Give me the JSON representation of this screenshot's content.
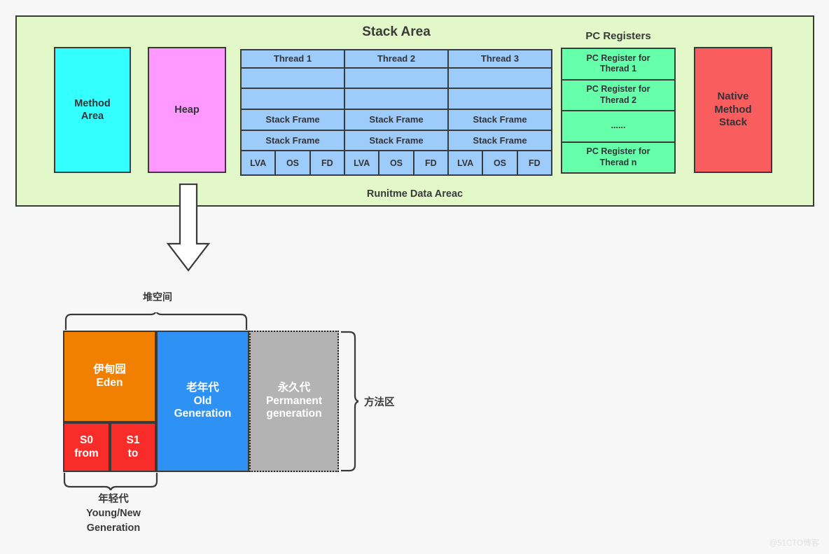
{
  "runtime": {
    "caption": "Runitme Data Areac",
    "method_area": "Method\nArea",
    "heap": "Heap",
    "native_method_stack": "Native\nMethod\nStack"
  },
  "stack_area": {
    "title": "Stack Area",
    "threads": [
      {
        "name": "Thread 1",
        "empty_rows": [
          "",
          ""
        ],
        "frames": [
          "Stack Frame",
          "Stack Frame"
        ],
        "parts": [
          "LVA",
          "OS",
          "FD"
        ]
      },
      {
        "name": "Thread 2",
        "empty_rows": [
          "",
          ""
        ],
        "frames": [
          "Stack Frame",
          "Stack Frame"
        ],
        "parts": [
          "LVA",
          "OS",
          "FD"
        ]
      },
      {
        "name": "Thread 3",
        "empty_rows": [
          "",
          ""
        ],
        "frames": [
          "Stack Frame",
          "Stack Frame"
        ],
        "parts": [
          "LVA",
          "OS",
          "FD"
        ]
      }
    ]
  },
  "pc_registers": {
    "title": "PC Registers",
    "cells": [
      "PC Register for\nTherad 1",
      "PC Register for\nTherad 2",
      "......",
      "PC Register for\nTherad n"
    ]
  },
  "heap_detail": {
    "heap_space_label": "堆空间",
    "young_gen_label": "年轻代\nYoung/New\nGeneration",
    "method_area_label": "方法区",
    "eden": "伊甸园\nEden",
    "s0": "S0\nfrom",
    "s1": "S1\nto",
    "old_generation": "老年代\nOld\nGeneration",
    "permanent_generation": "永久代\nPermanent\ngeneration"
  },
  "watermark": "@51CTO博客",
  "colors": {
    "page_background": "#f7f7f7",
    "runtime_background": "#e3f8c9",
    "outline": "#3a3a3a",
    "method_area": "#33ffff",
    "heap": "#ff99ff",
    "stack_cell": "#9dcbfa",
    "pc_register": "#66ffaa",
    "native_method_stack": "#fa5d5d",
    "eden": "#f28000",
    "survivor": "#f82c28",
    "old_generation": "#2e92f5",
    "permanent_generation": "#b3b3b3"
  }
}
